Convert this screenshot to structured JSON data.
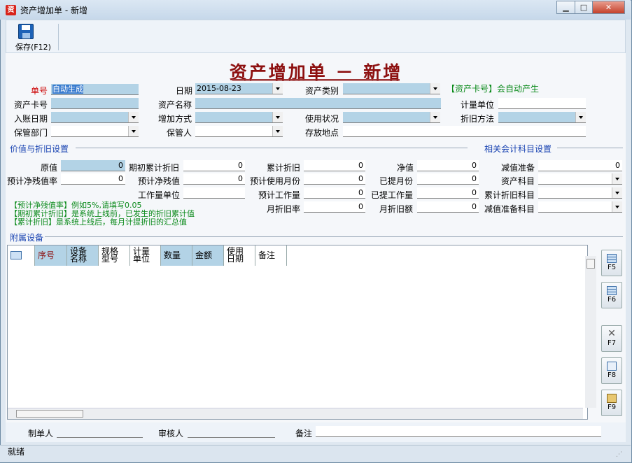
{
  "window": {
    "title": "资产增加单 - 新增",
    "app_icon": "资",
    "min": "▁",
    "max": "□",
    "close": "✕"
  },
  "toolbar": {
    "save_label": "保存(F12)"
  },
  "form": {
    "title": "资产增加单 － 新增",
    "fields": {
      "doc_no": {
        "label": "单号",
        "value": "自动生成"
      },
      "date": {
        "label": "日期",
        "value": "2015-08-23"
      },
      "asset_category": {
        "label": "资产类别",
        "value": ""
      },
      "auto_card_note": "【资产卡号】会自动产生",
      "asset_card": {
        "label": "资产卡号",
        "value": ""
      },
      "asset_name": {
        "label": "资产名称",
        "value": ""
      },
      "measure_unit": {
        "label": "计量单位",
        "value": ""
      },
      "entry_date": {
        "label": "入账日期",
        "value": ""
      },
      "add_method": {
        "label": "增加方式",
        "value": ""
      },
      "use_status": {
        "label": "使用状况",
        "value": ""
      },
      "depr_method": {
        "label": "折旧方法",
        "value": ""
      },
      "custody_dept": {
        "label": "保管部门",
        "value": ""
      },
      "custodian": {
        "label": "保管人",
        "value": ""
      },
      "location": {
        "label": "存放地点",
        "value": ""
      }
    },
    "value_section": {
      "title": "价值与折旧设置"
    },
    "account_section": {
      "title": "相关会计科目设置"
    },
    "values": {
      "original": {
        "label": "原值",
        "value": "0"
      },
      "residual_rate": {
        "label": "预计净残值率",
        "value": "0"
      },
      "opening_depr": {
        "label": "期初累计折旧",
        "value": "0"
      },
      "est_residual": {
        "label": "预计净残值",
        "value": "0"
      },
      "workload_unit": {
        "label": "工作量单位",
        "value": ""
      },
      "accum_depr": {
        "label": "累计折旧",
        "value": "0"
      },
      "est_months": {
        "label": "预计使用月份",
        "value": "0"
      },
      "est_workload": {
        "label": "预计工作量",
        "value": "0"
      },
      "monthly_rate": {
        "label": "月折旧率",
        "value": "0"
      },
      "net_value": {
        "label": "净值",
        "value": "0"
      },
      "months_depr": {
        "label": "已提月份",
        "value": "0"
      },
      "workload_done": {
        "label": "已提工作量",
        "value": "0"
      },
      "monthly_amount": {
        "label": "月折旧额",
        "value": "0"
      },
      "impairment": {
        "label": "减值准备",
        "value": "0"
      },
      "asset_account": {
        "label": "资产科目",
        "value": ""
      },
      "depr_account": {
        "label": "累计折旧科目",
        "value": ""
      },
      "impair_account": {
        "label": "减值准备科目",
        "value": ""
      }
    },
    "notes": [
      "【预计净残值率】例如5%,请填写0.05",
      "【期初累计折旧】是系统上线前，已发生的折旧累计值",
      "【累计折旧】是系统上线后，每月计提折旧的汇总值"
    ],
    "attached_section": {
      "title": "附属设备"
    },
    "grid": {
      "columns": [
        "序号",
        "设备名称",
        "规格型号",
        "计量单位",
        "数量",
        "金额",
        "使用日期",
        "备注"
      ]
    },
    "side_buttons": [
      "F5",
      "F6",
      "F7",
      "F8",
      "F9"
    ],
    "footer": {
      "maker": "制单人",
      "checker": "审核人",
      "remark": "备注"
    }
  },
  "status": {
    "text": "就绪"
  }
}
